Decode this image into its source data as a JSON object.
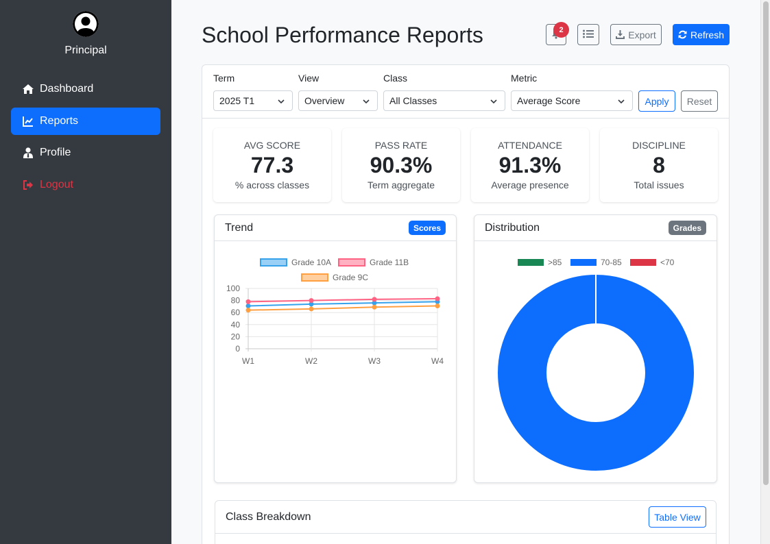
{
  "sidebar": {
    "role": "Principal",
    "items": [
      {
        "label": "Dashboard"
      },
      {
        "label": "Reports"
      },
      {
        "label": "Profile"
      },
      {
        "label": "Logout"
      }
    ]
  },
  "header": {
    "title": "School Performance Reports",
    "notification_count": "2",
    "export_label": "Export",
    "refresh_label": "Refresh"
  },
  "filters": {
    "term": {
      "label": "Term",
      "value": "2025 T1"
    },
    "view": {
      "label": "View",
      "value": "Overview"
    },
    "class": {
      "label": "Class",
      "value": "All Classes"
    },
    "metric": {
      "label": "Metric",
      "value": "Average Score"
    },
    "apply_label": "Apply",
    "reset_label": "Reset"
  },
  "stats": [
    {
      "label": "AVG SCORE",
      "value": "77.3",
      "sub": "% across classes"
    },
    {
      "label": "PASS RATE",
      "value": "90.3%",
      "sub": "Term aggregate"
    },
    {
      "label": "ATTENDANCE",
      "value": "91.3%",
      "sub": "Average presence"
    },
    {
      "label": "DISCIPLINE",
      "value": "8",
      "sub": "Total issues"
    }
  ],
  "trend": {
    "title": "Trend",
    "badge": "Scores"
  },
  "distribution": {
    "title": "Distribution",
    "badge": "Grades"
  },
  "breakdown": {
    "title": "Class Breakdown",
    "button_label": "Table View"
  },
  "colors": {
    "primary": "#0d6efd",
    "danger": "#dc3545",
    "success": "#198754",
    "sidebar": "#343a40",
    "secondary": "#6c757d"
  },
  "chart_data": [
    {
      "type": "line",
      "x": [
        "W1",
        "W2",
        "W3",
        "W4"
      ],
      "ylim": [
        0,
        100
      ],
      "yticks": [
        0,
        20,
        40,
        60,
        80,
        100
      ],
      "legend": "top",
      "grid": true,
      "series": [
        {
          "name": "Grade 10A",
          "values": [
            71,
            74,
            76,
            78
          ],
          "color": "#36a2eb"
        },
        {
          "name": "Grade 11B",
          "values": [
            78,
            80,
            82,
            83
          ],
          "color": "#ff6384"
        },
        {
          "name": "Grade 9C",
          "values": [
            64,
            66,
            69,
            71
          ],
          "color": "#ff9f40"
        }
      ]
    },
    {
      "type": "pie",
      "donut": true,
      "legend": "top",
      "categories": [
        ">85",
        "70-85",
        "<70"
      ],
      "values": [
        0,
        100,
        0
      ],
      "colors": [
        "#198754",
        "#0d6efd",
        "#dc3545"
      ]
    }
  ]
}
